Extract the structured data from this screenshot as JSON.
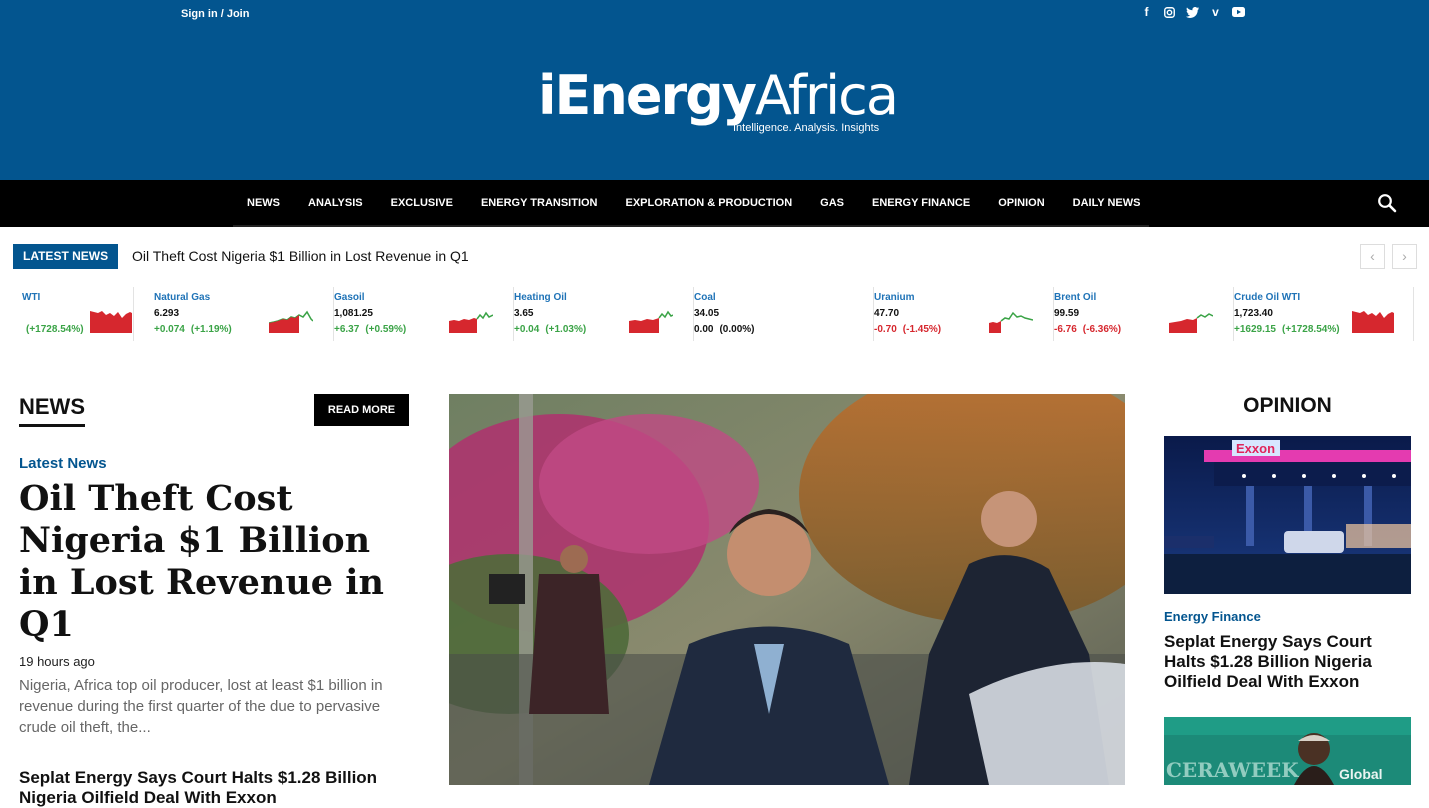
{
  "topbar": {
    "signin_label": "Sign in / Join",
    "social_icons": [
      "facebook-icon",
      "instagram-icon",
      "twitter-icon",
      "vimeo-icon",
      "youtube-icon"
    ]
  },
  "logo": {
    "word_a": "iEnergy",
    "word_b": "Africa",
    "tagline": "Intelligence. Analysis. Insights"
  },
  "nav": {
    "items": [
      "NEWS",
      "ANALYSIS",
      "EXCLUSIVE",
      "ENERGY TRANSITION",
      "EXPLORATION & PRODUCTION",
      "GAS",
      "ENERGY FINANCE",
      "OPINION",
      "DAILY NEWS"
    ]
  },
  "ticker": {
    "badge": "LATEST NEWS",
    "headline": "Oil Theft Cost Nigeria $1 Billion in Lost Revenue in Q1",
    "prev": "‹",
    "next": "›"
  },
  "quotes": [
    {
      "name": "WTI",
      "price": "",
      "change": "",
      "pct": "(+1728.54%)",
      "dir": "neg"
    },
    {
      "name": "Natural Gas",
      "price": "6.293",
      "change": "+0.074",
      "pct": "(+1.19%)",
      "dir": "pos"
    },
    {
      "name": "Gasoil",
      "price": "1,081.25",
      "change": "+6.37",
      "pct": "(+0.59%)",
      "dir": "pos"
    },
    {
      "name": "Heating Oil",
      "price": "3.65",
      "change": "+0.04",
      "pct": "(+1.03%)",
      "dir": "pos"
    },
    {
      "name": "Coal",
      "price": "34.05",
      "change": "0.00",
      "pct": "(0.00%)",
      "dir": "zero"
    },
    {
      "name": "Uranium",
      "price": "47.70",
      "change": "-0.70",
      "pct": "(-1.45%)",
      "dir": "neg"
    },
    {
      "name": "Brent Oil",
      "price": "99.59",
      "change": "-6.76",
      "pct": "(-6.36%)",
      "dir": "neg"
    },
    {
      "name": "Crude Oil WTI",
      "price": "1,723.40",
      "change": "+1629.15",
      "pct": "(+1728.54%)",
      "dir": "pos"
    }
  ],
  "news": {
    "heading": "NEWS",
    "read_more": "READ MORE",
    "category": "Latest News",
    "headline": "Oil Theft Cost Nigeria $1 Billion in Lost Revenue in Q1",
    "time_ago": "19 hours ago",
    "excerpt": "Nigeria, Africa top oil producer, lost at least $1 billion in revenue during the first quarter of the due to pervasive crude oil theft, the...",
    "second_headline": "Seplat Energy Says Court Halts $1.28 Billion Nigeria Oilfield Deal With Exxon"
  },
  "opinion": {
    "heading": "OPINION",
    "sign_text": "Exxon",
    "category": "Energy Finance",
    "title": "Seplat Energy Says Court Halts $1.28 Billion Nigeria Oilfield Deal With Exxon",
    "banner_a": "CERAWEEK",
    "banner_b": "Global"
  },
  "colors": {
    "brand_blue": "#03558f",
    "nav_black": "#000000",
    "positive": "#3aa346",
    "negative": "#d6272e"
  }
}
